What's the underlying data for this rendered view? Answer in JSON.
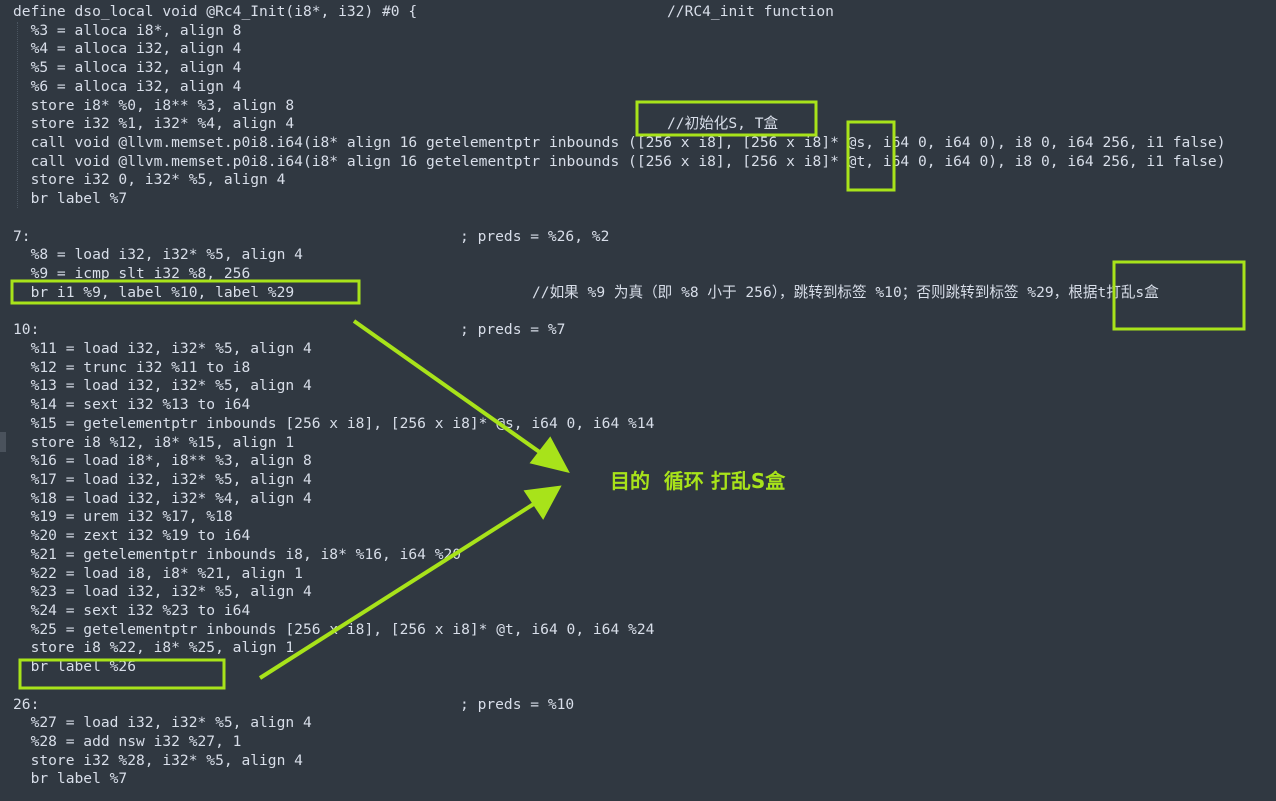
{
  "code": {
    "lines": [
      {
        "text": "define dso_local void @Rc4_Init(i8*, i32) #0 {",
        "comment": "//RC4_init function"
      },
      {
        "text": "  %3 = alloca i8*, align 8"
      },
      {
        "text": "  %4 = alloca i32, align 4"
      },
      {
        "text": "  %5 = alloca i32, align 4"
      },
      {
        "text": "  %6 = alloca i32, align 4"
      },
      {
        "text": "  store i8* %0, i8** %3, align 8"
      },
      {
        "text": "  store i32 %1, i32* %4, align 4",
        "comment": "//初始化S, T盒"
      },
      {
        "text": "  call void @llvm.memset.p0i8.i64(i8* align 16 getelementptr inbounds ([256 x i8], [256 x i8]* @s, i64 0, i64 0), i8 0, i64 256, i1 false)"
      },
      {
        "text": "  call void @llvm.memset.p0i8.i64(i8* align 16 getelementptr inbounds ([256 x i8], [256 x i8]* @t, i64 0, i64 0), i8 0, i64 256, i1 false)"
      },
      {
        "text": "  store i32 0, i32* %5, align 4"
      },
      {
        "text": "  br label %7"
      },
      {
        "text": ""
      },
      {
        "text": "7:",
        "comment": "; preds = %26, %2"
      },
      {
        "text": "  %8 = load i32, i32* %5, align 4"
      },
      {
        "text": "  %9 = icmp slt i32 %8, 256"
      },
      {
        "text": "  br i1 %9, label %10, label %29",
        "comment": "//如果 %9 为真（即 %8 小于 256），跳转到标签 %10；否则跳转到标签 %29，根据t打乱s盒"
      },
      {
        "text": ""
      },
      {
        "text": "10:",
        "comment": "; preds = %7"
      },
      {
        "text": "  %11 = load i32, i32* %5, align 4"
      },
      {
        "text": "  %12 = trunc i32 %11 to i8"
      },
      {
        "text": "  %13 = load i32, i32* %5, align 4"
      },
      {
        "text": "  %14 = sext i32 %13 to i64"
      },
      {
        "text": "  %15 = getelementptr inbounds [256 x i8], [256 x i8]* @s, i64 0, i64 %14"
      },
      {
        "text": "  store i8 %12, i8* %15, align 1"
      },
      {
        "text": "  %16 = load i8*, i8** %3, align 8"
      },
      {
        "text": "  %17 = load i32, i32* %5, align 4"
      },
      {
        "text": "  %18 = load i32, i32* %4, align 4"
      },
      {
        "text": "  %19 = urem i32 %17, %18"
      },
      {
        "text": "  %20 = zext i32 %19 to i64"
      },
      {
        "text": "  %21 = getelementptr inbounds i8, i8* %16, i64 %20"
      },
      {
        "text": "  %22 = load i8, i8* %21, align 1"
      },
      {
        "text": "  %23 = load i32, i32* %5, align 4"
      },
      {
        "text": "  %24 = sext i32 %23 to i64"
      },
      {
        "text": "  %25 = getelementptr inbounds [256 x i8], [256 x i8]* @t, i64 0, i64 %24"
      },
      {
        "text": "  store i8 %22, i8* %25, align 1"
      },
      {
        "text": "  br label %26"
      },
      {
        "text": ""
      },
      {
        "text": "26:",
        "comment": "; preds = %10"
      },
      {
        "text": "  %27 = load i32, i32* %5, align 4"
      },
      {
        "text": "  %28 = add nsw i32 %27, 1"
      },
      {
        "text": "  store i32 %28, i32* %5, align 4"
      },
      {
        "text": "  br label %7"
      }
    ]
  },
  "annotation": {
    "goal_text": "目的  循环 打乱S盒",
    "color": "#a8e31a"
  },
  "colors": {
    "background": "#303841",
    "text": "#d8dee9"
  }
}
